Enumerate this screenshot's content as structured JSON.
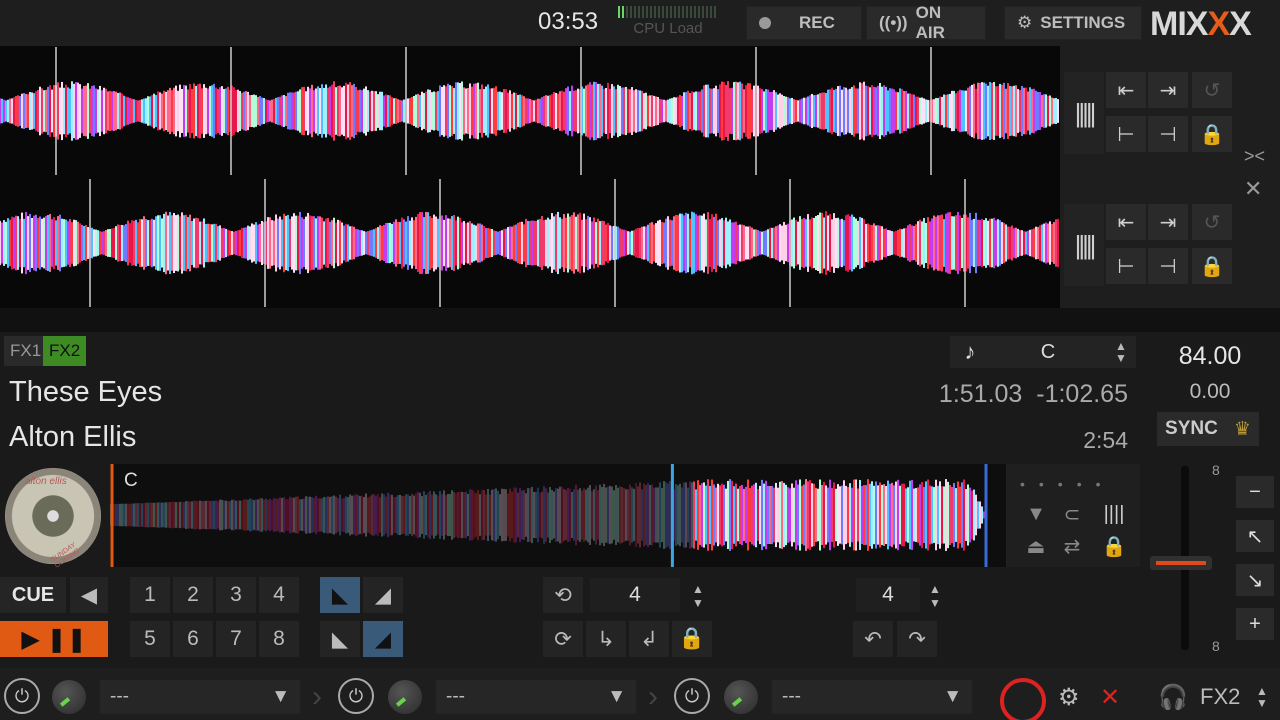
{
  "topbar": {
    "clock": "03:53",
    "cpu_label": "CPU Load",
    "cpu_load": 0.08,
    "rec_label": "REC",
    "on_air_label": "ON AIR",
    "settings_label": "SETTINGS",
    "logo": "MIXXX"
  },
  "deck": {
    "fx1": "FX1",
    "fx2": "FX2",
    "key": "C",
    "title": "These Eyes",
    "artist": "Alton Ellis",
    "time_elapsed": "1:51.03",
    "time_remaining": "-1:02.65",
    "duration": "2:54",
    "bpm": "84.00",
    "rate": "0.00",
    "sync_label": "SYNC",
    "overview_cue": "C",
    "cover_text_top": "alton ellis",
    "cover_text_bottom": "SUNDAY COMING",
    "cue_label": "CUE",
    "hotcues": [
      "1",
      "2",
      "3",
      "4",
      "5",
      "6",
      "7",
      "8"
    ],
    "loop_size": "4",
    "beatjump_size": "4",
    "rate_range_top": "8",
    "rate_range_bottom": "8",
    "playhead_position": 0.65
  },
  "mixer": {
    "effect_slots": [
      "---",
      "---",
      "---"
    ],
    "fx_unit": "FX2"
  },
  "colors": {
    "accent": "#e05a14",
    "fx_active": "#3e8b24",
    "playhead": "#3aa8e0"
  }
}
